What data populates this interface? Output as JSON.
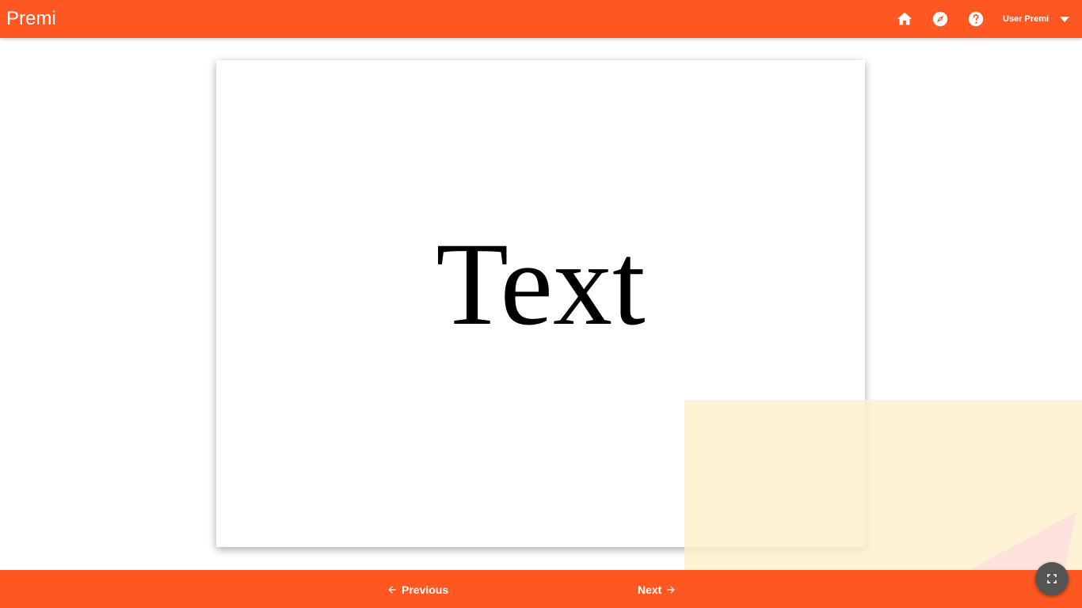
{
  "app": {
    "title": "Premi"
  },
  "header": {
    "icons": [
      "home-icon",
      "explore-icon",
      "help-icon"
    ],
    "user_label": "User Premi"
  },
  "slide": {
    "text": "Text"
  },
  "footer": {
    "previous_label": "Previous",
    "next_label": "Next",
    "fullscreen_icon": "fullscreen-icon"
  },
  "colors": {
    "accent": "#ff5722",
    "deco_yellow": "#fdefc9",
    "deco_pink": "#fde0dc",
    "fab": "#555555"
  }
}
